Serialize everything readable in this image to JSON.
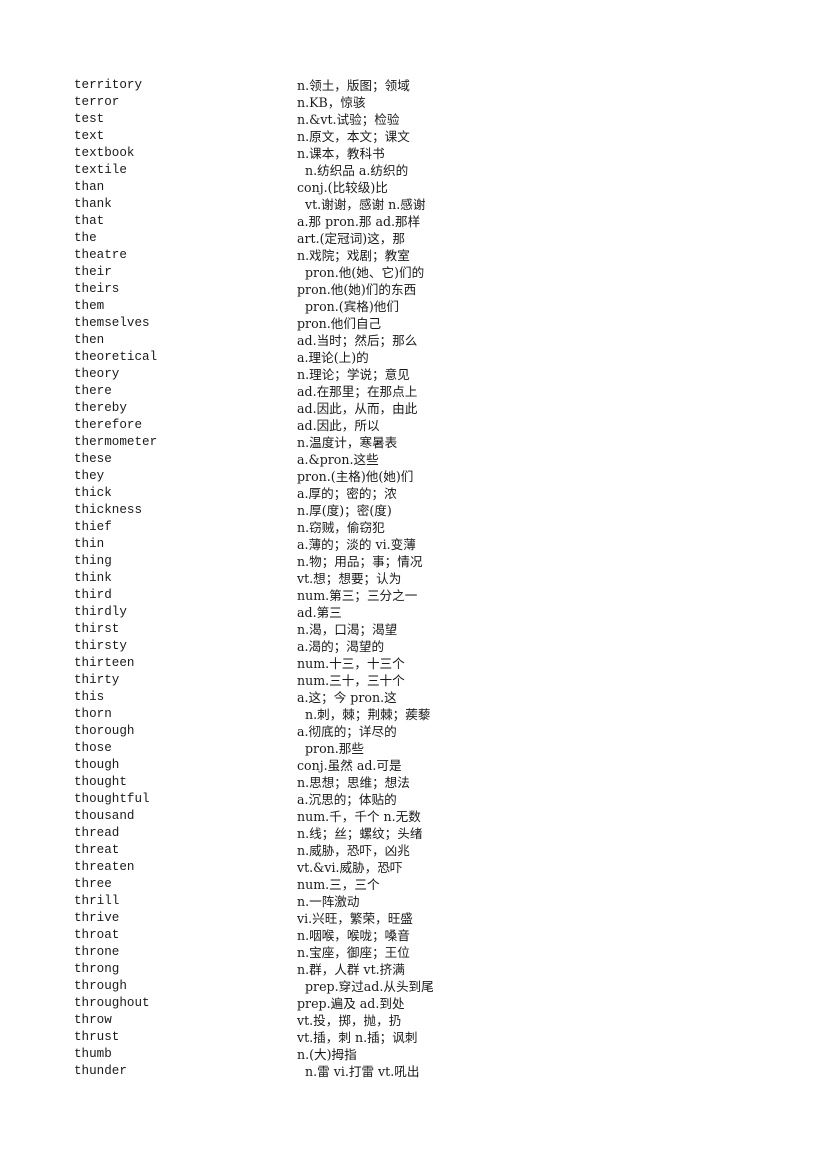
{
  "document": {
    "entries": [
      {
        "word": "territory",
        "definition": "n.领土，版图；领域",
        "indent": false
      },
      {
        "word": "terror",
        "definition": "n.KB，惊骇",
        "indent": false
      },
      {
        "word": "test",
        "definition": "n.&vt.试验；检验",
        "indent": false
      },
      {
        "word": "text",
        "definition": "n.原文，本文；课文",
        "indent": false
      },
      {
        "word": "textbook",
        "definition": "n.课本，教科书",
        "indent": false
      },
      {
        "word": "textile",
        "definition": "n.纺织品 a.纺织的",
        "indent": true
      },
      {
        "word": "than",
        "definition": "conj.(比较级)比",
        "indent": false
      },
      {
        "word": "thank",
        "definition": "vt.谢谢，感谢 n.感谢",
        "indent": true
      },
      {
        "word": "that",
        "definition": "a.那 pron.那 ad.那样",
        "indent": false
      },
      {
        "word": "the",
        "definition": "art.(定冠词)这，那",
        "indent": false
      },
      {
        "word": "theatre",
        "definition": "n.戏院；戏剧；教室",
        "indent": false
      },
      {
        "word": "their",
        "definition": "pron.他(她、它)们的",
        "indent": true
      },
      {
        "word": "theirs",
        "definition": "pron.他(她)们的东西",
        "indent": false
      },
      {
        "word": "them",
        "definition": "pron.(宾格)他们",
        "indent": true
      },
      {
        "word": "themselves",
        "definition": "pron.他们自己",
        "indent": false
      },
      {
        "word": "then",
        "definition": "ad.当时；然后；那么",
        "indent": false
      },
      {
        "word": "theoretical",
        "definition": "a.理论(上)的",
        "indent": false
      },
      {
        "word": "theory",
        "definition": "n.理论；学说；意见",
        "indent": false
      },
      {
        "word": "there",
        "definition": "ad.在那里；在那点上",
        "indent": false
      },
      {
        "word": "thereby",
        "definition": "ad.因此，从而，由此",
        "indent": false
      },
      {
        "word": "therefore",
        "definition": "ad.因此，所以",
        "indent": false
      },
      {
        "word": "thermometer",
        "definition": "n.温度计，寒暑表",
        "indent": false
      },
      {
        "word": "these",
        "definition": "a.&pron.这些",
        "indent": false
      },
      {
        "word": "they",
        "definition": "pron.(主格)他(她)们",
        "indent": false
      },
      {
        "word": "thick",
        "definition": "a.厚的；密的；浓",
        "indent": false
      },
      {
        "word": "thickness",
        "definition": "n.厚(度)；密(度)",
        "indent": false
      },
      {
        "word": "thief",
        "definition": "n.窃贼，偷窃犯",
        "indent": false
      },
      {
        "word": "thin",
        "definition": "a.薄的；淡的 vi.变薄",
        "indent": false
      },
      {
        "word": "thing",
        "definition": "n.物；用品；事；情况",
        "indent": false
      },
      {
        "word": "think",
        "definition": "vt.想；想要；认为",
        "indent": false
      },
      {
        "word": "third",
        "definition": "num.第三；三分之一",
        "indent": false
      },
      {
        "word": "thirdly",
        "definition": "ad.第三",
        "indent": false
      },
      {
        "word": "thirst",
        "definition": "n.渴，口渴；渴望",
        "indent": false
      },
      {
        "word": "thirsty",
        "definition": "a.渴的；渴望的",
        "indent": false
      },
      {
        "word": "thirteen",
        "definition": "num.十三，十三个",
        "indent": false
      },
      {
        "word": "thirty",
        "definition": "num.三十，三十个",
        "indent": false
      },
      {
        "word": "this",
        "definition": "a.这；今 pron.这",
        "indent": false
      },
      {
        "word": "thorn",
        "definition": "n.刺，棘；荆棘；蒺藜",
        "indent": true
      },
      {
        "word": "thorough",
        "definition": "a.彻底的；详尽的",
        "indent": false
      },
      {
        "word": "those",
        "definition": "pron.那些",
        "indent": true
      },
      {
        "word": "though",
        "definition": "conj.虽然 ad.可是",
        "indent": false
      },
      {
        "word": "thought",
        "definition": "n.思想；思维；想法",
        "indent": false
      },
      {
        "word": "thoughtful",
        "definition": "a.沉思的；体贴的",
        "indent": false
      },
      {
        "word": "thousand",
        "definition": "num.千，千个 n.无数",
        "indent": false
      },
      {
        "word": "thread",
        "definition": "n.线；丝；螺纹；头绪",
        "indent": false
      },
      {
        "word": "threat",
        "definition": "n.威胁，恐吓，凶兆",
        "indent": false
      },
      {
        "word": "threaten",
        "definition": "vt.&vi.威胁，恐吓",
        "indent": false
      },
      {
        "word": "three",
        "definition": "num.三，三个",
        "indent": false
      },
      {
        "word": "thrill",
        "definition": "n.一阵激动",
        "indent": false
      },
      {
        "word": "thrive",
        "definition": "vi.兴旺，繁荣，旺盛",
        "indent": false
      },
      {
        "word": "throat",
        "definition": "n.咽喉，喉咙；嗓音",
        "indent": false
      },
      {
        "word": "throne",
        "definition": "n.宝座，御座；王位",
        "indent": false
      },
      {
        "word": "throng",
        "definition": "n.群，人群 vt.挤满",
        "indent": false
      },
      {
        "word": "through",
        "definition": "prep.穿过ad.从头到尾",
        "indent": true
      },
      {
        "word": "throughout",
        "definition": "prep.遍及 ad.到处",
        "indent": false
      },
      {
        "word": "throw",
        "definition": "vt.投，掷，抛，扔",
        "indent": false
      },
      {
        "word": "thrust",
        "definition": "vt.插，刺 n.插；讽刺",
        "indent": false
      },
      {
        "word": "thumb",
        "definition": "n.(大)拇指",
        "indent": false
      },
      {
        "word": "thunder",
        "definition": "n.雷 vi.打雷 vt.吼出",
        "indent": true
      }
    ]
  }
}
